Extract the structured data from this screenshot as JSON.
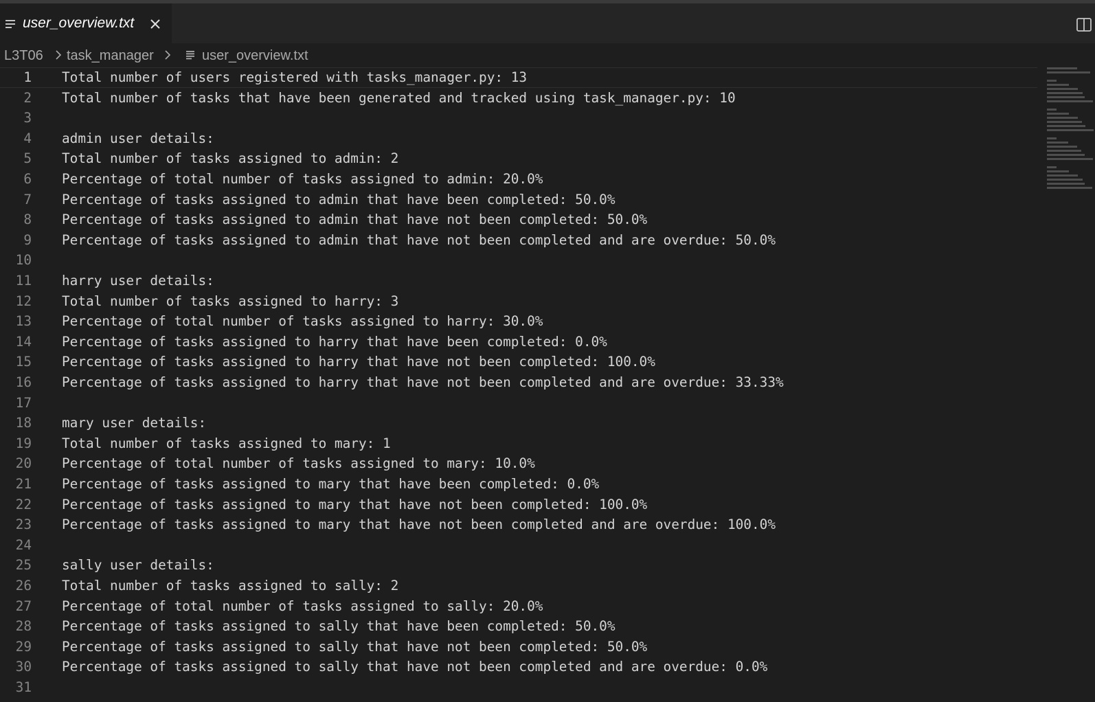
{
  "tab": {
    "title": "user_overview.txt",
    "file_icon": "text-file-icon",
    "close_icon": "close-icon"
  },
  "editor_actions": {
    "split_icon": "split-editor-icon"
  },
  "breadcrumb": {
    "items": [
      "L3T06",
      "task_manager",
      "user_overview.txt"
    ],
    "separator_icon": "chevron-right-icon",
    "file_icon": "text-file-icon"
  },
  "editor": {
    "current_line": 1,
    "lines": [
      {
        "n": "1",
        "text": "Total number of users registered with tasks_manager.py: 13"
      },
      {
        "n": "2",
        "text": "Total number of tasks that have been generated and tracked using task_manager.py: 10"
      },
      {
        "n": "3",
        "text": ""
      },
      {
        "n": "4",
        "text": "admin user details:"
      },
      {
        "n": "5",
        "text": "Total number of tasks assigned to admin: 2"
      },
      {
        "n": "6",
        "text": "Percentage of total number of tasks assigned to admin: 20.0%"
      },
      {
        "n": "7",
        "text": "Percentage of tasks assigned to admin that have been completed: 50.0%"
      },
      {
        "n": "8",
        "text": "Percentage of tasks assigned to admin that have not been completed: 50.0%"
      },
      {
        "n": "9",
        "text": "Percentage of tasks assigned to admin that have not been completed and are overdue: 50.0%"
      },
      {
        "n": "10",
        "text": ""
      },
      {
        "n": "11",
        "text": "harry user details:"
      },
      {
        "n": "12",
        "text": "Total number of tasks assigned to harry: 3"
      },
      {
        "n": "13",
        "text": "Percentage of total number of tasks assigned to harry: 30.0%"
      },
      {
        "n": "14",
        "text": "Percentage of tasks assigned to harry that have been completed: 0.0%"
      },
      {
        "n": "15",
        "text": "Percentage of tasks assigned to harry that have not been completed: 100.0%"
      },
      {
        "n": "16",
        "text": "Percentage of tasks assigned to harry that have not been completed and are overdue: 33.33%"
      },
      {
        "n": "17",
        "text": ""
      },
      {
        "n": "18",
        "text": "mary user details:"
      },
      {
        "n": "19",
        "text": "Total number of tasks assigned to mary: 1"
      },
      {
        "n": "20",
        "text": "Percentage of total number of tasks assigned to mary: 10.0%"
      },
      {
        "n": "21",
        "text": "Percentage of tasks assigned to mary that have been completed: 0.0%"
      },
      {
        "n": "22",
        "text": "Percentage of tasks assigned to mary that have not been completed: 100.0%"
      },
      {
        "n": "23",
        "text": "Percentage of tasks assigned to mary that have not been completed and are overdue: 100.0%"
      },
      {
        "n": "24",
        "text": ""
      },
      {
        "n": "25",
        "text": "sally user details:"
      },
      {
        "n": "26",
        "text": "Total number of tasks assigned to sally: 2"
      },
      {
        "n": "27",
        "text": "Percentage of total number of tasks assigned to sally: 20.0%"
      },
      {
        "n": "28",
        "text": "Percentage of tasks assigned to sally that have been completed: 50.0%"
      },
      {
        "n": "29",
        "text": "Percentage of tasks assigned to sally that have not been completed: 50.0%"
      },
      {
        "n": "30",
        "text": "Percentage of tasks assigned to sally that have not been completed and are overdue: 0.0%"
      },
      {
        "n": "31",
        "text": ""
      }
    ]
  },
  "colors": {
    "editor_bg": "#1e1e1e",
    "tabbar_bg": "#252526",
    "text": "#d4d4d4",
    "line_number": "#858585",
    "line_number_active": "#c6c6c6"
  }
}
